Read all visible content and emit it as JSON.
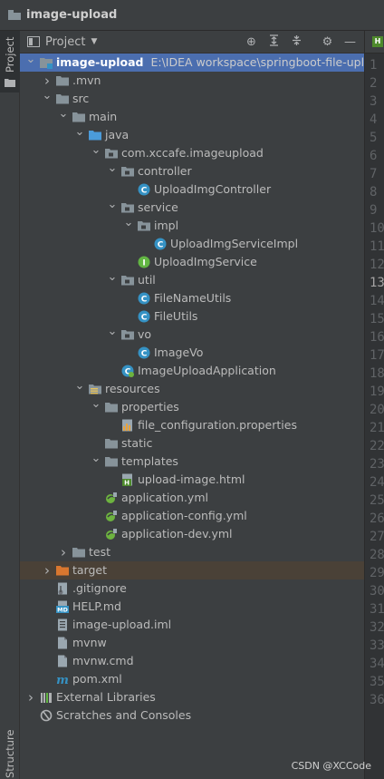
{
  "window": {
    "title": "image-upload"
  },
  "sidebar": {
    "project_tab": "Project",
    "structure_tab": "Structure"
  },
  "panel": {
    "title": "Project"
  },
  "tree": [
    {
      "label": "image-upload",
      "path": "E:\\IDEA workspace\\springboot-file-upload",
      "indent": 0,
      "arrow": "down",
      "icon": "module",
      "bold": true,
      "selected": true
    },
    {
      "label": ".mvn",
      "indent": 1,
      "arrow": "right",
      "icon": "folder"
    },
    {
      "label": "src",
      "indent": 1,
      "arrow": "down",
      "icon": "folder"
    },
    {
      "label": "main",
      "indent": 2,
      "arrow": "down",
      "icon": "folder"
    },
    {
      "label": "java",
      "indent": 3,
      "arrow": "down",
      "icon": "folder-src"
    },
    {
      "label": "com.xccafe.imageupload",
      "indent": 4,
      "arrow": "down",
      "icon": "package"
    },
    {
      "label": "controller",
      "indent": 5,
      "arrow": "down",
      "icon": "package"
    },
    {
      "label": "UploadImgController",
      "indent": 6,
      "arrow": "",
      "icon": "class"
    },
    {
      "label": "service",
      "indent": 5,
      "arrow": "down",
      "icon": "package"
    },
    {
      "label": "impl",
      "indent": 6,
      "arrow": "down",
      "icon": "package"
    },
    {
      "label": "UploadImgServiceImpl",
      "indent": 7,
      "arrow": "",
      "icon": "class"
    },
    {
      "label": "UploadImgService",
      "indent": 6,
      "arrow": "",
      "icon": "interface"
    },
    {
      "label": "util",
      "indent": 5,
      "arrow": "down",
      "icon": "package"
    },
    {
      "label": "FileNameUtils",
      "indent": 6,
      "arrow": "",
      "icon": "class"
    },
    {
      "label": "FileUtils",
      "indent": 6,
      "arrow": "",
      "icon": "class"
    },
    {
      "label": "vo",
      "indent": 5,
      "arrow": "down",
      "icon": "package"
    },
    {
      "label": "ImageVo",
      "indent": 6,
      "arrow": "",
      "icon": "class"
    },
    {
      "label": "ImageUploadApplication",
      "indent": 5,
      "arrow": "",
      "icon": "spring-class"
    },
    {
      "label": "resources",
      "indent": 3,
      "arrow": "down",
      "icon": "folder-res"
    },
    {
      "label": "properties",
      "indent": 4,
      "arrow": "down",
      "icon": "folder"
    },
    {
      "label": "file_configuration.properties",
      "indent": 5,
      "arrow": "",
      "icon": "properties"
    },
    {
      "label": "static",
      "indent": 4,
      "arrow": "",
      "icon": "folder"
    },
    {
      "label": "templates",
      "indent": 4,
      "arrow": "down",
      "icon": "folder"
    },
    {
      "label": "upload-image.html",
      "indent": 5,
      "arrow": "",
      "icon": "html"
    },
    {
      "label": "application.yml",
      "indent": 4,
      "arrow": "",
      "icon": "yml"
    },
    {
      "label": "application-config.yml",
      "indent": 4,
      "arrow": "",
      "icon": "yml"
    },
    {
      "label": "application-dev.yml",
      "indent": 4,
      "arrow": "",
      "icon": "yml"
    },
    {
      "label": "test",
      "indent": 2,
      "arrow": "right",
      "icon": "folder"
    },
    {
      "label": "target",
      "indent": 1,
      "arrow": "right",
      "icon": "folder-target",
      "highlight": true
    },
    {
      "label": ".gitignore",
      "indent": 1,
      "arrow": "",
      "icon": "gitignore"
    },
    {
      "label": "HELP.md",
      "indent": 1,
      "arrow": "",
      "icon": "md"
    },
    {
      "label": "image-upload.iml",
      "indent": 1,
      "arrow": "",
      "icon": "iml"
    },
    {
      "label": "mvnw",
      "indent": 1,
      "arrow": "",
      "icon": "file"
    },
    {
      "label": "mvnw.cmd",
      "indent": 1,
      "arrow": "",
      "icon": "file"
    },
    {
      "label": "pom.xml",
      "indent": 1,
      "arrow": "",
      "icon": "maven"
    },
    {
      "label": "External Libraries",
      "indent": 0,
      "arrow": "right",
      "icon": "libraries"
    },
    {
      "label": "Scratches and Consoles",
      "indent": 0,
      "arrow": "",
      "icon": "scratches"
    }
  ],
  "gutter": {
    "line_numbers": [
      "1",
      "2",
      "3",
      "4",
      "5",
      "6",
      "7",
      "8",
      "9",
      "10",
      "11",
      "12",
      "13",
      "14",
      "15",
      "16",
      "17",
      "18",
      "19",
      "20",
      "21",
      "22",
      "23",
      "24",
      "25",
      "26",
      "27",
      "28",
      "29",
      "30",
      "31",
      "32",
      "33",
      "34",
      "35",
      "36"
    ],
    "current_line": "13"
  },
  "watermark": "CSDN @XCCode",
  "colors": {
    "selection": "#4b6eaf",
    "highlight_row": "#4a4137",
    "panel_bg": "#3c3f41",
    "class_icon": "#3592c4",
    "interface_icon": "#62b543",
    "folder": "#87939a",
    "folder_target": "#d9772f",
    "folder_src": "#4b9bd9"
  }
}
